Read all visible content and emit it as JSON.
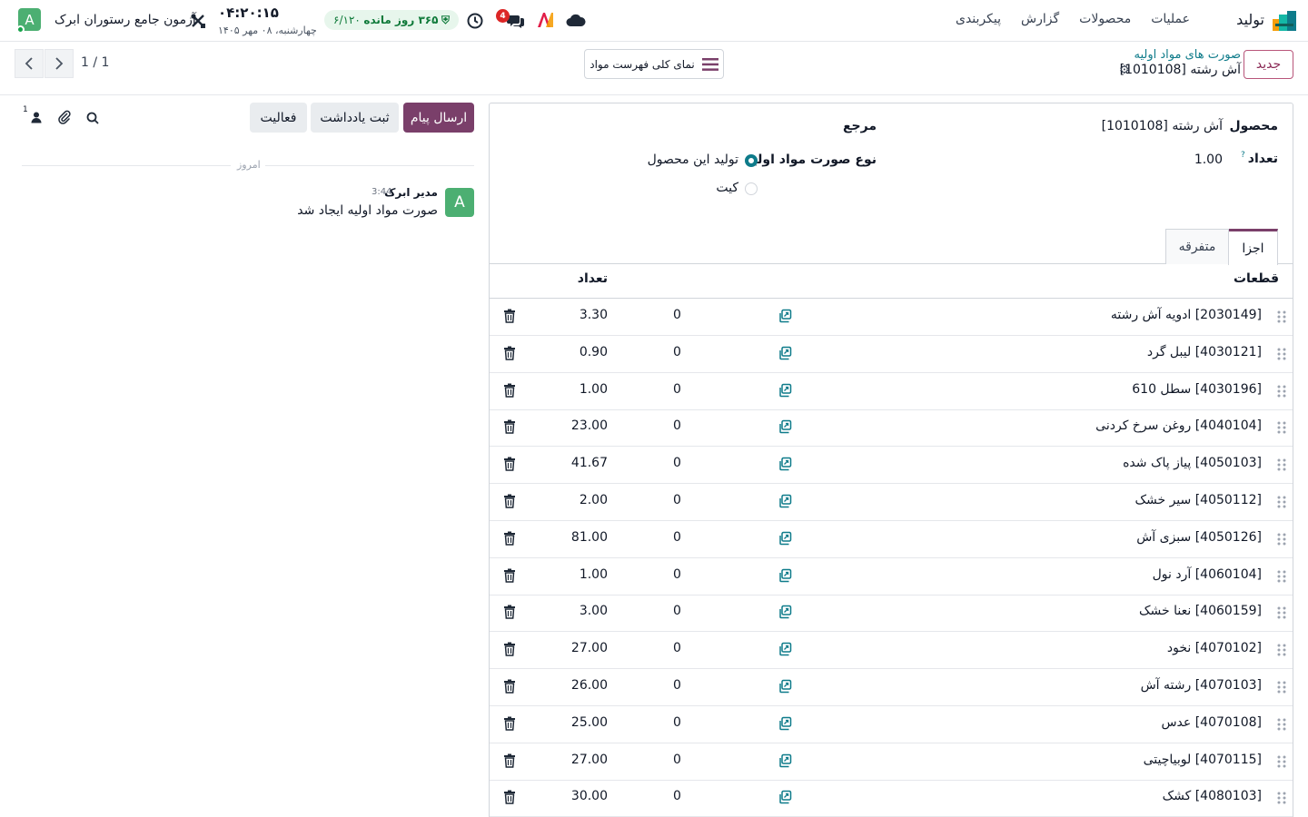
{
  "navbar": {
    "app_title": "تولید",
    "menu": [
      "عملیات",
      "محصولات",
      "گزارش",
      "پیکربندی"
    ],
    "chat_badge": "4",
    "trial": {
      "days_left": "۳۶۵ روز مانده",
      "date": "۶/۱۲۰"
    },
    "clock": {
      "time": "۰۴:۲۰:۱۵",
      "date": "چهارشنبه، ۰۸ مهر ۱۴۰۵"
    },
    "company": "آزمون جامع رستوران ابرک",
    "avatar_letter": "A"
  },
  "control_panel": {
    "new_button": "جدید",
    "breadcrumb_parent": "صورت های مواد اولیه",
    "breadcrumb_current": "[1010108] آش رشته",
    "overview_button": "نمای کلی فهرست مواد",
    "pager": "1 / 1"
  },
  "chatter": {
    "send_message": "ارسال پیام",
    "log_note": "ثبت یادداشت",
    "activity": "فعالیت",
    "followers_count": "1",
    "today_label": "امروز",
    "message": {
      "avatar_letter": "A",
      "author": "مدیر ابرک",
      "time": "3:44",
      "body": "صورت مواد اولیه ایجاد شد"
    }
  },
  "form": {
    "product_label": "محصول",
    "product_value": "[1010108] آش رشته",
    "quantity_label": "تعداد",
    "quantity_help": "?",
    "quantity_value": "1.00",
    "reference_label": "مرجع",
    "bom_type_label": "نوع صورت مواد اولیه",
    "bom_type_options": [
      {
        "label": "تولید این محصول",
        "selected": true
      },
      {
        "label": "کیت",
        "selected": false
      }
    ],
    "tabs": [
      {
        "label": "اجزا",
        "active": true
      },
      {
        "label": "متفرقه",
        "active": false
      }
    ],
    "table": {
      "headers": {
        "component": "قطعات",
        "quantity": "تعداد"
      },
      "rows": [
        {
          "component": "[2030149] ادویه آش رشته",
          "zero": "0",
          "qty": "3.30"
        },
        {
          "component": "[4030121] لیبل گرد",
          "zero": "0",
          "qty": "0.90"
        },
        {
          "component": "[4030196] سطل 610",
          "zero": "0",
          "qty": "1.00"
        },
        {
          "component": "[4040104] روغن سرخ کردنی",
          "zero": "0",
          "qty": "23.00"
        },
        {
          "component": "[4050103] پیاز پاک شده",
          "zero": "0",
          "qty": "41.67"
        },
        {
          "component": "[4050112] سیر خشک",
          "zero": "0",
          "qty": "2.00"
        },
        {
          "component": "[4050126] سبزی آش",
          "zero": "0",
          "qty": "81.00"
        },
        {
          "component": "[4060104] آرد نول",
          "zero": "0",
          "qty": "1.00"
        },
        {
          "component": "[4060159] نعنا خشک",
          "zero": "0",
          "qty": "3.00"
        },
        {
          "component": "[4070102] نخود",
          "zero": "0",
          "qty": "27.00"
        },
        {
          "component": "[4070103] رشته آش",
          "zero": "0",
          "qty": "26.00"
        },
        {
          "component": "[4070108] عدس",
          "zero": "0",
          "qty": "25.00"
        },
        {
          "component": "[4070115] لوبیاچیتی",
          "zero": "0",
          "qty": "27.00"
        },
        {
          "component": "[4080103] کشک",
          "zero": "0",
          "qty": "30.00"
        }
      ]
    }
  },
  "colors": {
    "primary": "#7a3f6a",
    "accent": "#0e7b8a",
    "avatar": "#4caf72",
    "badge": "#dc2626"
  }
}
